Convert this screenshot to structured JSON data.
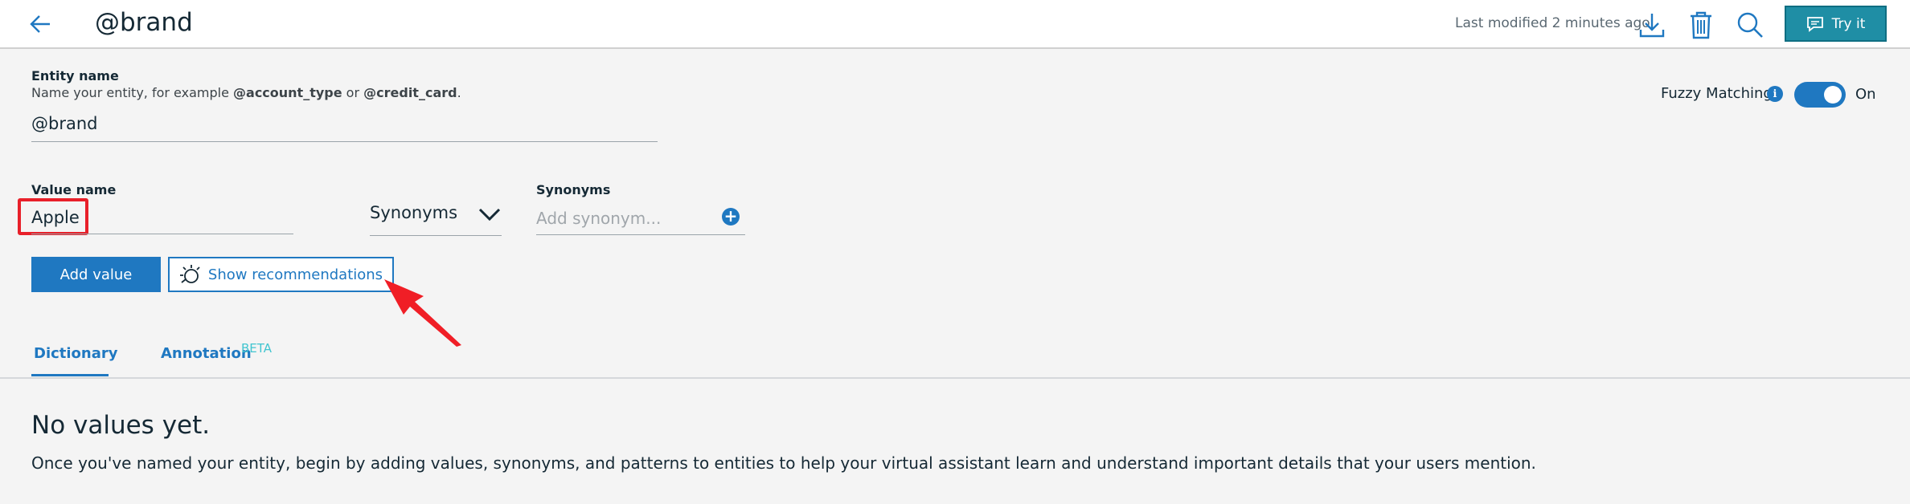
{
  "header": {
    "title": "@brand",
    "last_modified": "Last modified 2 minutes ago",
    "try_label": "Try it",
    "icons": [
      "back-arrow-icon",
      "download-icon",
      "trash-icon",
      "search-icon",
      "chat-icon"
    ]
  },
  "entity": {
    "label": "Entity name",
    "help_prefix": "Name your entity, for example ",
    "example1": "@account_type",
    "help_or": " or ",
    "example2": "@credit_card",
    "help_suffix": ".",
    "value": "@brand"
  },
  "fuzzy": {
    "label": "Fuzzy Matching",
    "info": "i",
    "state": "On"
  },
  "value": {
    "label": "Value name",
    "current": "Apple"
  },
  "type_select": {
    "selected": "Synonyms"
  },
  "synonyms": {
    "label": "Synonyms",
    "placeholder": "Add synonym..."
  },
  "buttons": {
    "add_value": "Add value",
    "show_recommendations": "Show recommendations"
  },
  "tabs": {
    "dictionary": "Dictionary",
    "annotation": "Annotation",
    "annotation_badge": "BETA"
  },
  "empty_state": {
    "title": "No values yet.",
    "description": "Once you've named your entity, begin by adding values, synonyms, and patterns to entities to help your virtual assistant learn and understand important details that your users mention."
  },
  "colors": {
    "accent": "#1f78c1",
    "try_button": "#1f8ea5",
    "highlight": "#e8202a",
    "beta": "#41c5d0"
  }
}
